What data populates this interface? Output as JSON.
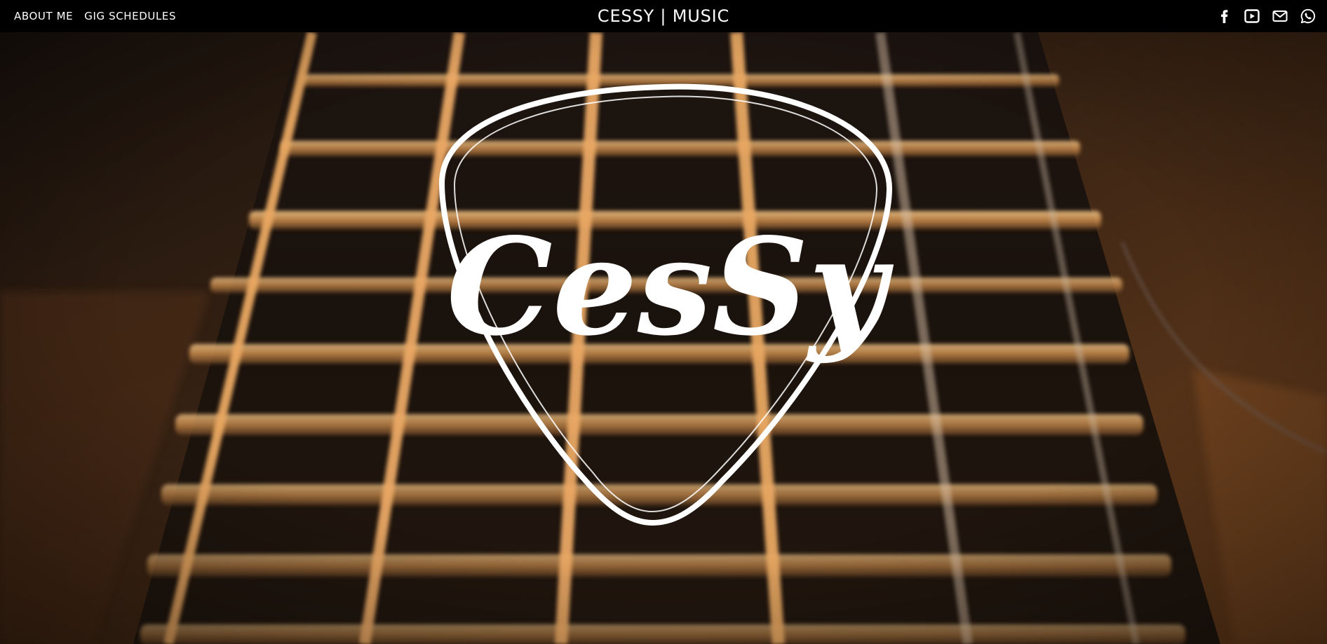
{
  "nav": {
    "links": [
      {
        "label": "ABOUT ME"
      },
      {
        "label": "GIG SCHEDULES"
      }
    ]
  },
  "brand": {
    "title": "CESSY | MUSIC"
  },
  "social": [
    {
      "icon": "facebook-icon"
    },
    {
      "icon": "youtube-icon"
    },
    {
      "icon": "email-icon"
    },
    {
      "icon": "whatsapp-icon"
    }
  ],
  "hero": {
    "logo_text": "CesSy",
    "background": "guitar fretboard and strings photograph"
  },
  "colors": {
    "navbar_bg": "#000000",
    "text": "#ffffff",
    "string_gold": "#e2a25a",
    "wood_dark": "#2a1a10"
  }
}
